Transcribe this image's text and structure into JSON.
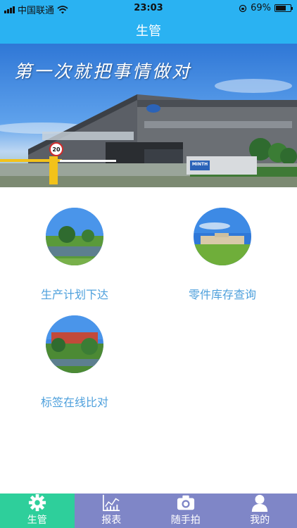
{
  "status_bar": {
    "carrier": "中国联通",
    "time": "23:03",
    "battery": "69%",
    "battery_level": 0.69
  },
  "nav": {
    "title": "生管"
  },
  "banner": {
    "slogan": "第一次就把事情做对",
    "gate_sign": "20",
    "building_logo": "MINTH"
  },
  "modules": [
    {
      "label": "生产计划下达",
      "icon": "park-pond-photo"
    },
    {
      "label": "零件库存查询",
      "icon": "campus-lawn-photo"
    },
    {
      "label": "标签在线比对",
      "icon": "factory-trees-photo"
    }
  ],
  "tabbar": {
    "tabs": [
      {
        "label": "生管",
        "icon": "gear-icon",
        "active": true
      },
      {
        "label": "报表",
        "icon": "chart-icon",
        "active": false
      },
      {
        "label": "随手拍",
        "icon": "camera-icon",
        "active": false
      },
      {
        "label": "我的",
        "icon": "person-icon",
        "active": false
      }
    ]
  }
}
